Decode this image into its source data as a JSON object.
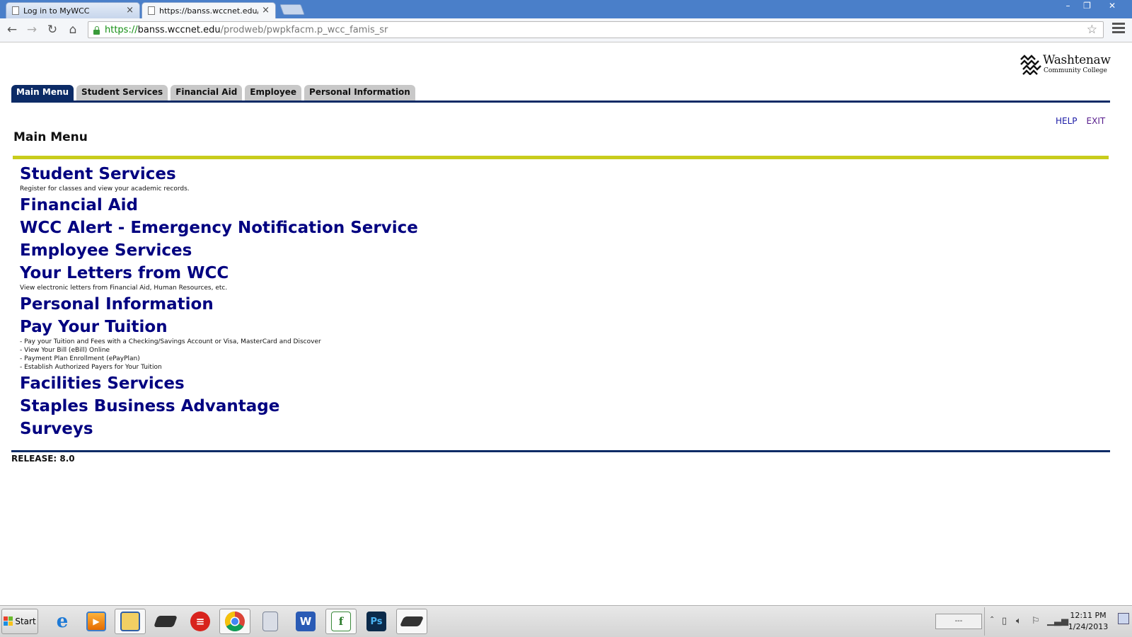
{
  "browser": {
    "tabs": [
      {
        "title": "Log in to MyWCC",
        "close": "×"
      },
      {
        "title": "https://banss.wccnet.edu/se",
        "close": "×"
      }
    ],
    "window_buttons": {
      "minimize": "–",
      "restore": "❐",
      "close": "✕"
    },
    "nav": {
      "back": "←",
      "forward": "→",
      "reload": "↻",
      "home": "⌂"
    },
    "url": {
      "scheme": "https://",
      "host": "banss.wccnet.edu",
      "path": "/prodweb/pwpkfacm.p_wcc_famis_sr"
    },
    "bookmark_star": "☆"
  },
  "page": {
    "logo": {
      "line1": "Washtenaw",
      "line2": "Community College"
    },
    "tabs": [
      "Main Menu",
      "Student Services",
      "Financial Aid",
      "Employee",
      "Personal Information"
    ],
    "links": {
      "help": "HELP",
      "exit": "EXIT"
    },
    "title": "Main Menu",
    "menu": [
      {
        "title": "Student Services",
        "desc": [
          "Register for classes and view your academic records."
        ]
      },
      {
        "title": "Financial Aid",
        "desc": []
      },
      {
        "title": "WCC Alert - Emergency Notification Service",
        "desc": []
      },
      {
        "title": "Employee Services",
        "desc": []
      },
      {
        "title": "Your Letters from WCC",
        "desc": [
          "View electronic letters from Financial Aid, Human Resources, etc."
        ]
      },
      {
        "title": "Personal Information",
        "desc": []
      },
      {
        "title": "Pay Your Tuition",
        "desc": [
          "- Pay your Tuition and Fees with a Checking/Savings Account or Visa, MasterCard and Discover",
          "- View Your Bill (eBill) Online",
          "- Payment Plan Enrollment (ePayPlan)",
          "- Establish Authorized Payers for Your Tuition"
        ]
      },
      {
        "title": "Facilities Services",
        "desc": []
      },
      {
        "title": "Staples Business Advantage",
        "desc": []
      },
      {
        "title": "Surveys",
        "desc": []
      }
    ],
    "release": "RELEASE: 8.0"
  },
  "taskbar": {
    "start": "Start",
    "input_box": "---",
    "clock": {
      "time": "12:11 PM",
      "date": "1/24/2013"
    },
    "apps": [
      "internet-explorer",
      "media-player",
      "file-explorer",
      "scanner",
      "acrobat",
      "chrome",
      "calculator",
      "word",
      "sheets",
      "photoshop",
      "laptop"
    ],
    "app_labels": {
      "word": "W",
      "photoshop": "Ps",
      "sheets": "f"
    }
  }
}
